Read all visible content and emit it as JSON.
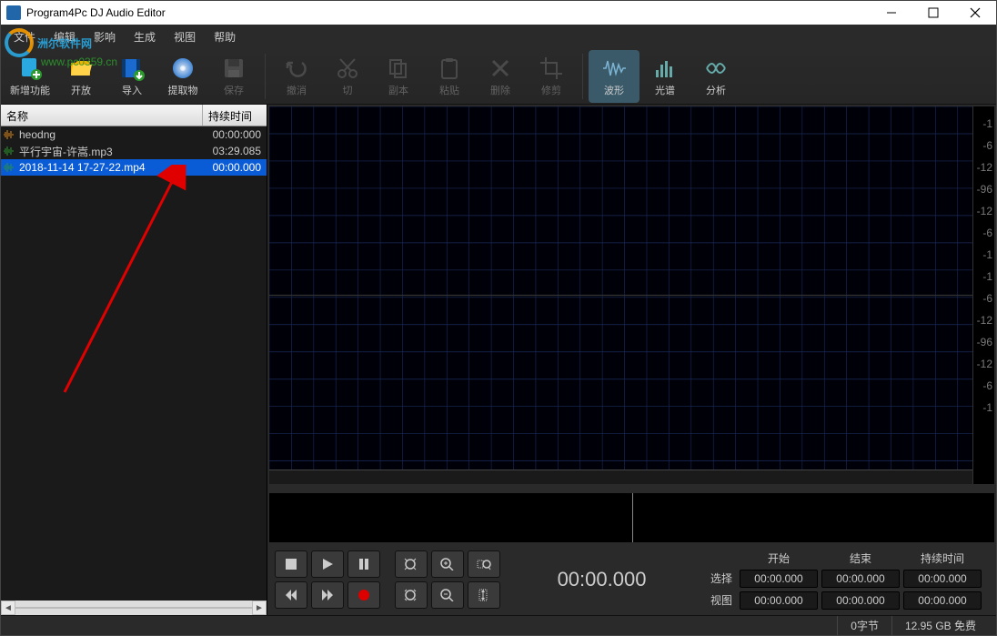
{
  "app_title": "Program4Pc DJ Audio Editor",
  "watermark": {
    "brand": "洲尔软件网",
    "url": "www.pc0359.cn"
  },
  "menu": [
    "文件",
    "编辑",
    "影响",
    "生成",
    "视图",
    "帮助"
  ],
  "toolbar": {
    "primary": [
      {
        "name": "new",
        "label": "新增功能",
        "color": "#2aa8e0"
      },
      {
        "name": "open",
        "label": "开放",
        "color": "#f2b100"
      },
      {
        "name": "import",
        "label": "导入",
        "color": "#2a7bd6"
      },
      {
        "name": "extract",
        "label": "提取物",
        "color": "#2aa8e0"
      },
      {
        "name": "save",
        "label": "保存",
        "color": "#888",
        "disabled": true
      }
    ],
    "edit": [
      {
        "name": "undo",
        "label": "撤消"
      },
      {
        "name": "cut",
        "label": "切"
      },
      {
        "name": "copy",
        "label": "副本"
      },
      {
        "name": "paste",
        "label": "粘贴"
      },
      {
        "name": "delete",
        "label": "删除"
      },
      {
        "name": "crop",
        "label": "修剪"
      }
    ],
    "view": [
      {
        "name": "waveform",
        "label": "波形",
        "active": true
      },
      {
        "name": "spectrum",
        "label": "光谱"
      },
      {
        "name": "analyze",
        "label": "分析"
      }
    ]
  },
  "sidebar": {
    "col_name": "名称",
    "col_time": "持续时间",
    "items": [
      {
        "name": "heodng",
        "time": "00:00:000",
        "icon_color": "#e08a1a"
      },
      {
        "name": "平行宇宙-许嵩.mp3",
        "time": "03:29.085",
        "icon_color": "#2c9a2c"
      },
      {
        "name": "2018-11-14 17-27-22.mp4",
        "time": "00:00.000",
        "icon_color": "#2c9a2c",
        "selected": true
      }
    ]
  },
  "waveform": {
    "scale_values": [
      "-1",
      "-6",
      "-12",
      "-96",
      "-12",
      "-6",
      "-1",
      "-1",
      "-6",
      "-12",
      "-96",
      "-12",
      "-6",
      "-1"
    ]
  },
  "transport": {
    "current_time": "00:00.000"
  },
  "range": {
    "headers": [
      "开始",
      "结束",
      "持续时间"
    ],
    "rows": [
      {
        "label": "选择",
        "vals": [
          "00:00.000",
          "00:00.000",
          "00:00.000"
        ]
      },
      {
        "label": "视图",
        "vals": [
          "00:00.000",
          "00:00.000",
          "00:00.000"
        ]
      }
    ]
  },
  "status": {
    "bytes": "0字节",
    "disk": "12.95 GB 免费"
  }
}
